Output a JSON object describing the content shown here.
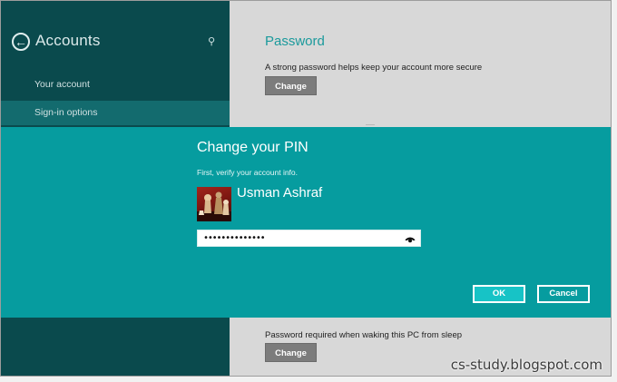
{
  "sidebar": {
    "title": "Accounts",
    "items": [
      {
        "label": "Your account"
      },
      {
        "label": "Sign-in options"
      }
    ]
  },
  "content": {
    "password_title": "Password",
    "password_desc": "A strong password helps keep your account more secure",
    "change_label": "Change",
    "sleep_desc": "Password required when waking this PC from sleep",
    "sleep_change_label": "Change"
  },
  "dialog": {
    "title": "Change your PIN",
    "subtitle": "First, verify your account info.",
    "user_name": "Usman Ashraf",
    "password_value": "••••••••••••••",
    "ok_label": "OK",
    "cancel_label": "Cancel"
  },
  "watermark": "cs-study.blogspot.com",
  "colors": {
    "sidebar": "#0a4a4d",
    "sidebar_selected": "#136b6e",
    "dialog": "#069c9f",
    "accent": "#1b9a9c",
    "ok_button": "#17c3c6"
  },
  "icons": [
    "back-arrow-icon",
    "search-icon",
    "reveal-password-icon"
  ]
}
